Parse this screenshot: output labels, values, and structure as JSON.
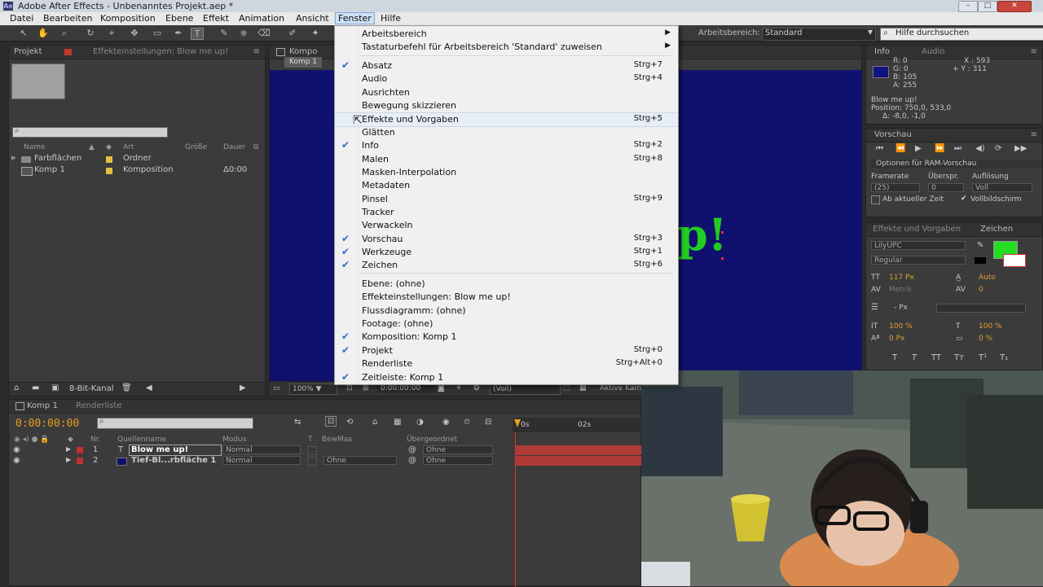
{
  "window": {
    "title": "Adobe After Effects - Unbenanntes Projekt.aep *",
    "app_icon": "Ae"
  },
  "menubar": [
    "Datei",
    "Bearbeiten",
    "Komposition",
    "Ebene",
    "Effekt",
    "Animation",
    "Ansicht",
    "Fenster",
    "Hilfe"
  ],
  "toolbar": {
    "workspace_label": "Arbeitsbereich:",
    "workspace_value": "Standard",
    "help_placeholder": "Hilfe durchsuchen"
  },
  "project_panel": {
    "tab_project": "Projekt",
    "tab_effects": "Effekteinstellungen: Blow me up!",
    "columns": [
      "Name",
      "Art",
      "Größe",
      "Dauer"
    ],
    "rows": [
      {
        "name": "Farbflächen",
        "type": "Ordner",
        "size": "",
        "duration": ""
      },
      {
        "name": "Komp 1",
        "type": "Komposition",
        "size": "",
        "duration": "Δ0:00"
      }
    ],
    "bit_depth": "8-Bit-Kanal"
  },
  "composition": {
    "tab": "Kompo",
    "sub_tab": "Komp 1",
    "visible_text": "p!",
    "footer": {
      "zoom": "100%",
      "timecode": "0:00:00:00",
      "resolution": "(Voll)",
      "camera": "Aktive Kam"
    }
  },
  "info_panel": {
    "tab_info": "Info",
    "tab_audio": "Audio",
    "r": "R: 0",
    "g": "G: 0",
    "b": "B: 105",
    "a": "A: 255",
    "x": "X : 593",
    "y": "+ Y : 311",
    "layer_name": "Blow me up!",
    "position": "Position: 750,0, 533,0",
    "delta": "Δ: -8,0, -1,0",
    "swatch_color": "#0f1480"
  },
  "preview_panel": {
    "tab": "Vorschau",
    "options": "Optionen für RAM-Vorschau",
    "framerate_label": "Framerate",
    "skip_label": "Überspr.",
    "resolution_label": "Auflösung",
    "framerate": "(25)",
    "skip": "0",
    "resolution": "Voll",
    "from_current": "Ab aktueller Zeit",
    "fullscreen": "Vollbildschirm"
  },
  "char_panel": {
    "tab_effects": "Effekte und Vorgaben",
    "tab_char": "Zeichen",
    "font": "LilyUPC",
    "style": "Regular",
    "size": "117 Px",
    "leading": "Auto",
    "kerning": "Metrik",
    "tracking": "0",
    "stroke": "- Px",
    "vscale": "100 %",
    "hscale": "100 %",
    "baseline": "0 Px",
    "tsume": "0 %",
    "fill_color": "#22dd22",
    "style_buttons": [
      "T",
      "T",
      "TT",
      "Tт",
      "T¹",
      "T₁"
    ]
  },
  "timeline": {
    "tab_comp": "Komp 1",
    "tab_render": "Renderliste",
    "timecode": "0:00:00:00",
    "headers": [
      "Nr.",
      "Quellenname",
      "Modus",
      "T",
      "BewMas",
      "Übergeordnet"
    ],
    "ruler": [
      "0s",
      "02s"
    ],
    "layers": [
      {
        "num": "1",
        "name": "Blow me up!",
        "mode": "Normal",
        "bewmas": "",
        "parent": "Ohne",
        "color": "#c03030"
      },
      {
        "num": "2",
        "name": "Tief-Bl...rbfläche 1",
        "mode": "Normal",
        "bewmas": "Ohne",
        "parent": "Ohne",
        "color": "#c03030"
      }
    ]
  },
  "fenster_menu": {
    "items": [
      {
        "label": "Arbeitsbereich",
        "shortcut": "",
        "checked": false,
        "submenu": true
      },
      {
        "label": "Tastaturbefehl für Arbeitsbereich 'Standard' zuweisen",
        "shortcut": "",
        "checked": false,
        "submenu": true
      },
      {
        "label": "Absatz",
        "shortcut": "Strg+7",
        "checked": true
      },
      {
        "label": "Audio",
        "shortcut": "Strg+4",
        "checked": false
      },
      {
        "label": "Ausrichten",
        "shortcut": "",
        "checked": false
      },
      {
        "label": "Bewegung skizzieren",
        "shortcut": "",
        "checked": false
      },
      {
        "label": "Effekte und Vorgaben",
        "shortcut": "Strg+5",
        "checked": false
      },
      {
        "label": "Glätten",
        "shortcut": "",
        "checked": false
      },
      {
        "label": "Info",
        "shortcut": "Strg+2",
        "checked": true
      },
      {
        "label": "Malen",
        "shortcut": "Strg+8",
        "checked": false
      },
      {
        "label": "Masken-Interpolation",
        "shortcut": "",
        "checked": false
      },
      {
        "label": "Metadaten",
        "shortcut": "",
        "checked": false
      },
      {
        "label": "Pinsel",
        "shortcut": "Strg+9",
        "checked": false
      },
      {
        "label": "Tracker",
        "shortcut": "",
        "checked": false
      },
      {
        "label": "Verwackeln",
        "shortcut": "",
        "checked": false
      },
      {
        "label": "Vorschau",
        "shortcut": "Strg+3",
        "checked": true
      },
      {
        "label": "Werkzeuge",
        "shortcut": "Strg+1",
        "checked": true
      },
      {
        "label": "Zeichen",
        "shortcut": "Strg+6",
        "checked": true
      },
      {
        "label": "Ebene: (ohne)",
        "shortcut": "",
        "checked": false
      },
      {
        "label": "Effekteinstellungen: Blow me up!",
        "shortcut": "",
        "checked": false
      },
      {
        "label": "Flussdiagramm: (ohne)",
        "shortcut": "",
        "checked": false
      },
      {
        "label": "Footage: (ohne)",
        "shortcut": "",
        "checked": false
      },
      {
        "label": "Komposition: Komp 1",
        "shortcut": "",
        "checked": true
      },
      {
        "label": "Projekt",
        "shortcut": "Strg+0",
        "checked": true
      },
      {
        "label": "Renderliste",
        "shortcut": "Strg+Alt+0",
        "checked": false
      },
      {
        "label": "Zeitleiste: Komp 1",
        "shortcut": "",
        "checked": true
      }
    ]
  }
}
